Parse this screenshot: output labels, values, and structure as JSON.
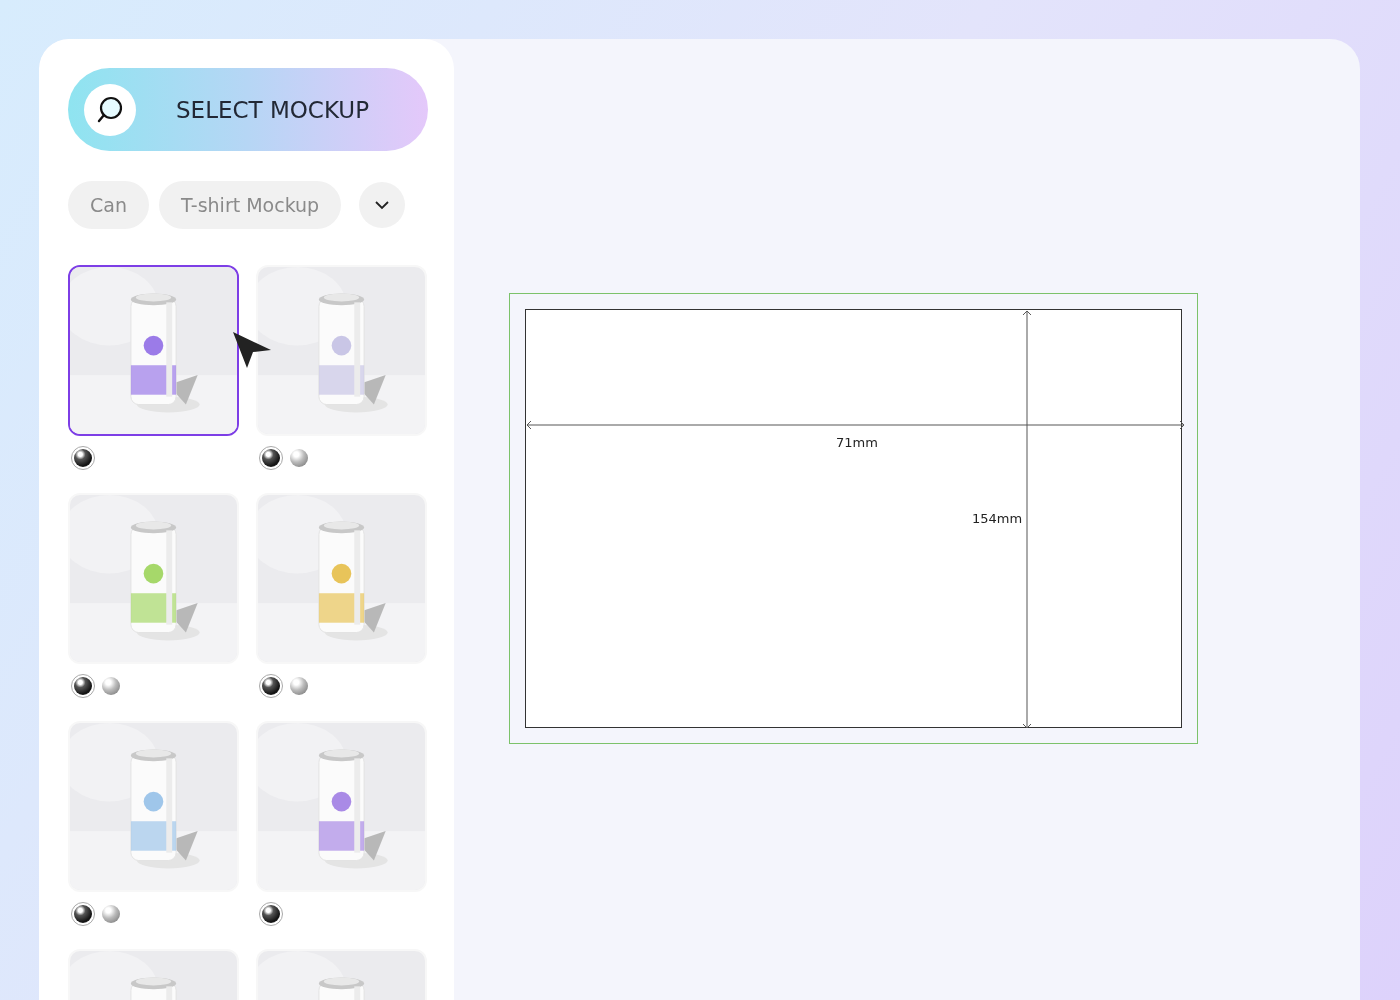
{
  "select_button": {
    "label": "SELECT MOCKUP"
  },
  "filters": [
    {
      "label": "Can"
    },
    {
      "label": "T-shirt Mockup"
    }
  ],
  "mockups": [
    {
      "kind": "picture",
      "selected": true,
      "materials": [
        {
          "kind": "dark",
          "selected": true
        }
      ]
    },
    {
      "kind": "picture",
      "selected": false,
      "materials": [
        {
          "kind": "dark",
          "selected": true
        },
        {
          "kind": "light",
          "selected": false
        }
      ]
    },
    {
      "kind": "picture",
      "selected": false,
      "materials": [
        {
          "kind": "dark",
          "selected": true
        },
        {
          "kind": "light",
          "selected": false
        }
      ]
    },
    {
      "kind": "picture",
      "selected": false,
      "materials": [
        {
          "kind": "dark",
          "selected": true
        },
        {
          "kind": "light",
          "selected": false
        }
      ]
    },
    {
      "kind": "picture",
      "selected": false,
      "materials": [
        {
          "kind": "dark",
          "selected": true
        },
        {
          "kind": "light",
          "selected": false
        }
      ]
    },
    {
      "kind": "picture",
      "selected": false,
      "materials": [
        {
          "kind": "dark",
          "selected": true
        }
      ]
    },
    {
      "kind": "picture",
      "selected": false
    },
    {
      "kind": "picture",
      "selected": false
    }
  ],
  "canvas": {
    "width_label": "71mm",
    "height_label": "154mm"
  }
}
